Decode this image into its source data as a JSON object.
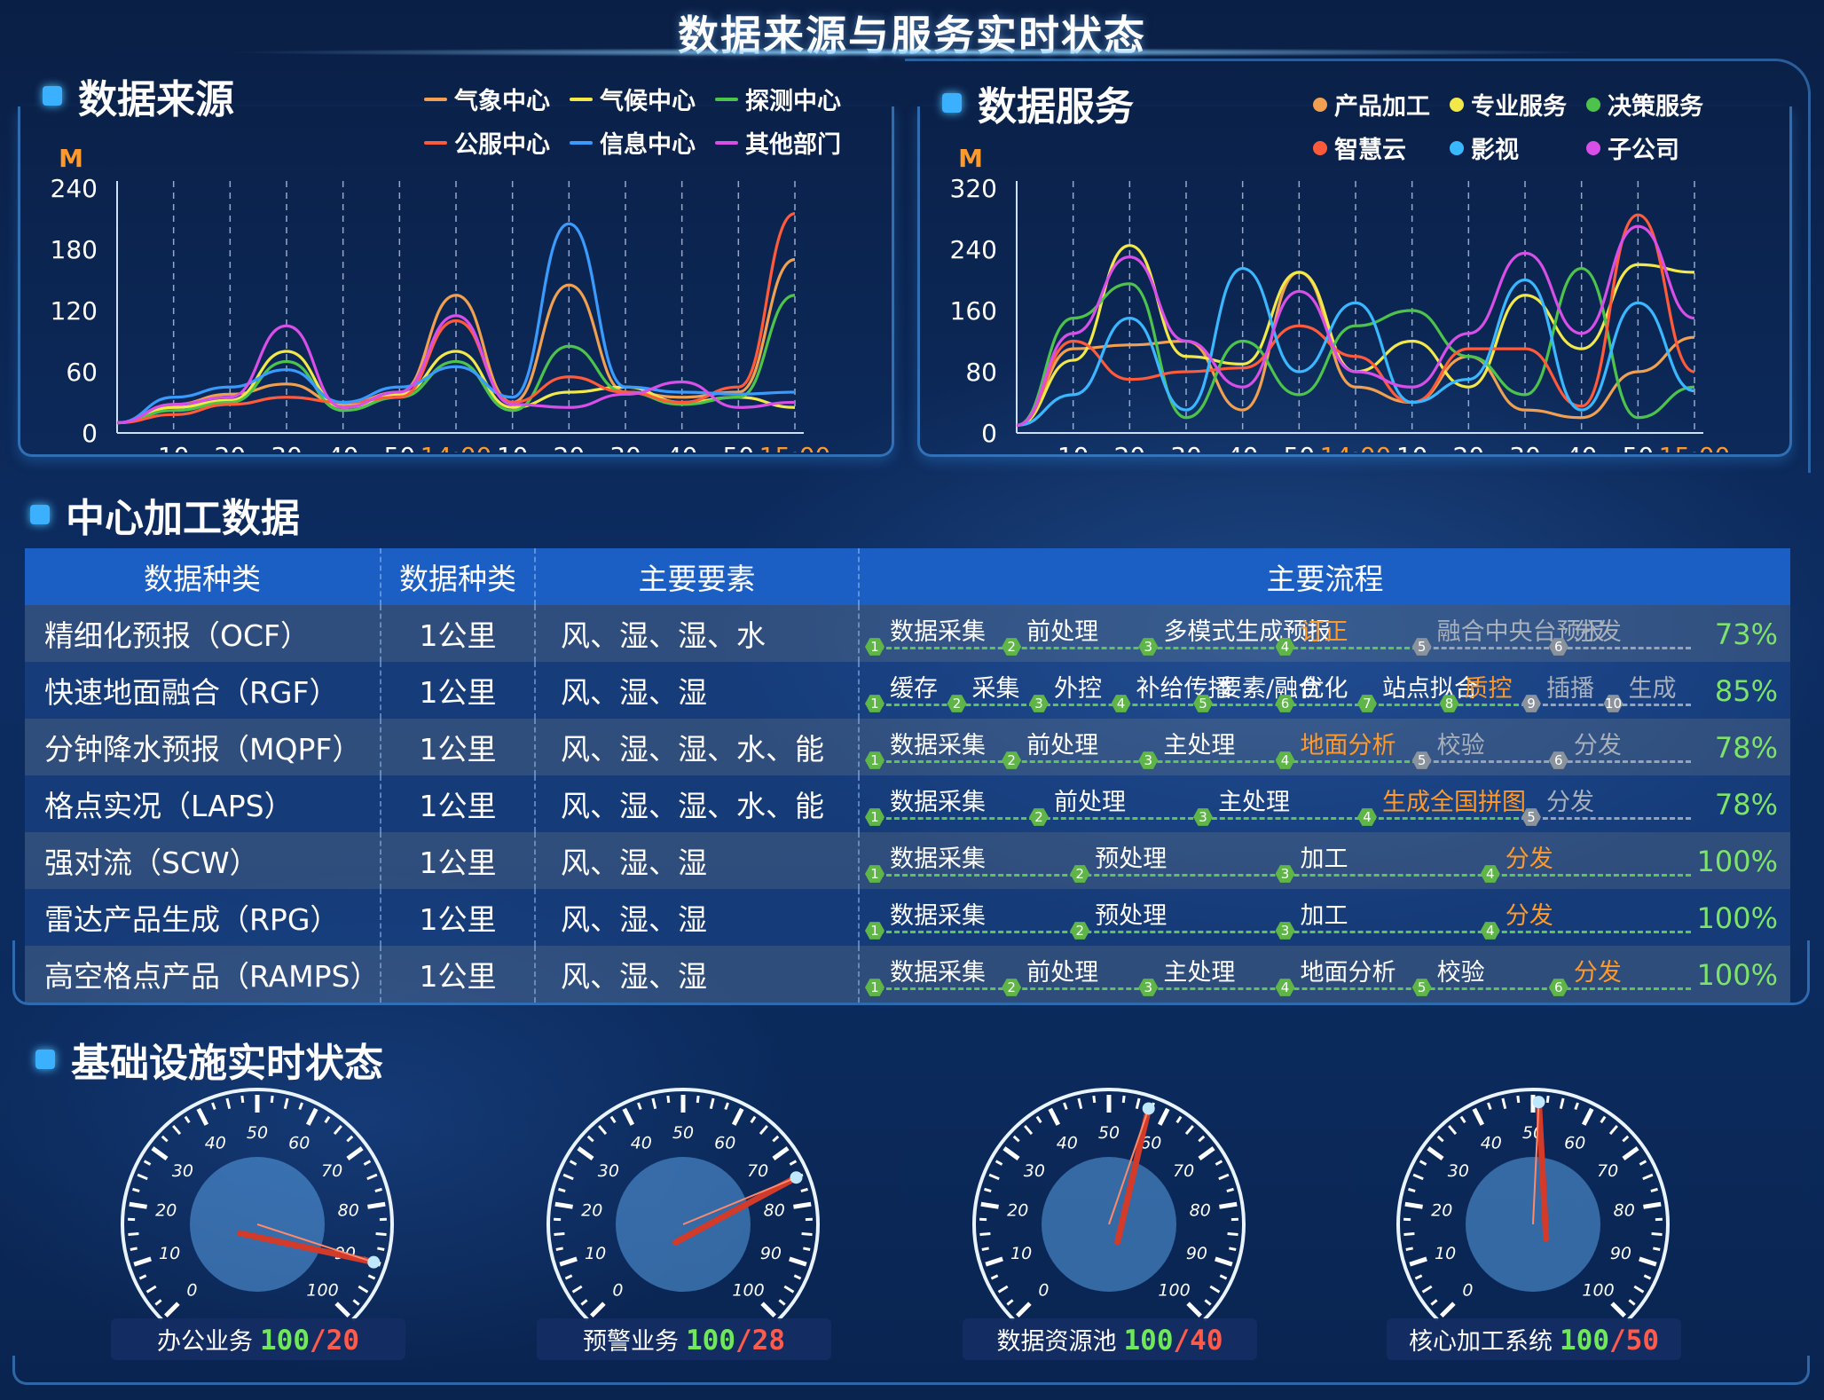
{
  "page_title": "数据来源与服务实时状态",
  "source_panel": {
    "title": "数据来源",
    "unit": "M",
    "legend": [
      {
        "name": "气象中心",
        "color": "#f0a050"
      },
      {
        "name": "气候中心",
        "color": "#f2e84a"
      },
      {
        "name": "探测中心",
        "color": "#4cc44c"
      },
      {
        "name": "公服中心",
        "color": "#ff5a3a"
      },
      {
        "name": "信息中心",
        "color": "#3a9bff"
      },
      {
        "name": "其他部门",
        "color": "#d84fe8"
      }
    ]
  },
  "service_panel": {
    "title": "数据服务",
    "unit": "M",
    "legend": [
      {
        "name": "产品加工",
        "color": "#f0a050"
      },
      {
        "name": "专业服务",
        "color": "#f2e84a"
      },
      {
        "name": "决策服务",
        "color": "#4cc44c"
      },
      {
        "name": "智慧云",
        "color": "#ff5a3a"
      },
      {
        "name": "影视",
        "color": "#3ab8ff"
      },
      {
        "name": "子公司",
        "color": "#d84fe8"
      }
    ]
  },
  "chart_data": [
    {
      "type": "line",
      "title": "数据来源",
      "ylabel": "M",
      "ylim": [
        0,
        240
      ],
      "yticks": [
        "0",
        "60",
        "120",
        "180",
        "240"
      ],
      "x": [
        "",
        "10",
        "20",
        "30",
        "40",
        "50",
        "14:00",
        "10",
        "20",
        "30",
        "40",
        "50",
        "15:00"
      ],
      "highlight_ticks": [
        "14:00",
        "15:00"
      ],
      "series": [
        {
          "name": "气象中心",
          "color": "#f0a050",
          "values": [
            10,
            28,
            38,
            48,
            28,
            40,
            135,
            30,
            145,
            40,
            35,
            40,
            170
          ]
        },
        {
          "name": "气候中心",
          "color": "#f2e84a",
          "values": [
            10,
            25,
            32,
            80,
            25,
            38,
            80,
            25,
            40,
            45,
            30,
            35,
            25
          ]
        },
        {
          "name": "探测中心",
          "color": "#4cc44c",
          "values": [
            10,
            22,
            30,
            70,
            22,
            35,
            70,
            22,
            85,
            40,
            28,
            35,
            135
          ]
        },
        {
          "name": "公服中心",
          "color": "#ff5a3a",
          "values": [
            10,
            18,
            28,
            35,
            30,
            35,
            110,
            30,
            55,
            40,
            30,
            45,
            215
          ]
        },
        {
          "name": "信息中心",
          "color": "#3a9bff",
          "values": [
            10,
            35,
            45,
            62,
            30,
            45,
            65,
            35,
            205,
            45,
            40,
            38,
            40
          ]
        },
        {
          "name": "其他部门",
          "color": "#d84fe8",
          "values": [
            10,
            28,
            35,
            105,
            25,
            40,
            115,
            28,
            25,
            38,
            50,
            25,
            30
          ]
        }
      ]
    },
    {
      "type": "line",
      "title": "数据服务",
      "ylabel": "M",
      "ylim": [
        0,
        320
      ],
      "yticks": [
        "0",
        "80",
        "160",
        "240",
        "320"
      ],
      "x": [
        "",
        "10",
        "20",
        "30",
        "40",
        "50",
        "14:00",
        "10",
        "20",
        "30",
        "40",
        "50",
        "15:00"
      ],
      "highlight_ticks": [
        "14:00",
        "15:00"
      ],
      "series": [
        {
          "name": "产品加工",
          "color": "#f0a050",
          "values": [
            10,
            110,
            115,
            120,
            30,
            210,
            60,
            40,
            100,
            30,
            20,
            80,
            125
          ]
        },
        {
          "name": "专业服务",
          "color": "#f2e84a",
          "values": [
            10,
            95,
            245,
            100,
            90,
            210,
            80,
            120,
            60,
            180,
            110,
            220,
            210
          ]
        },
        {
          "name": "决策服务",
          "color": "#4cc44c",
          "values": [
            10,
            150,
            195,
            20,
            120,
            50,
            140,
            160,
            100,
            50,
            215,
            20,
            60
          ]
        },
        {
          "name": "智慧云",
          "color": "#ff5a3a",
          "values": [
            10,
            120,
            70,
            80,
            85,
            140,
            100,
            40,
            110,
            110,
            35,
            285,
            80
          ]
        },
        {
          "name": "影视",
          "color": "#3ab8ff",
          "values": [
            10,
            50,
            150,
            30,
            215,
            80,
            170,
            40,
            70,
            200,
            30,
            170,
            55
          ]
        },
        {
          "name": "子公司",
          "color": "#d84fe8",
          "values": [
            10,
            130,
            230,
            120,
            60,
            185,
            80,
            60,
            130,
            235,
            130,
            270,
            150
          ]
        }
      ]
    }
  ],
  "center_section": {
    "title": "中心加工数据",
    "headers": [
      "数据种类",
      "数据种类",
      "主要要素",
      "主要流程"
    ],
    "rows": [
      {
        "name": "精细化预报（OCF）",
        "res": "1公里",
        "elements": "风、湿、湿、水",
        "pct": "73%",
        "steps": [
          "数据采集",
          "前处理",
          "多模式生成预报",
          "订正",
          "融合中央台预报",
          "分发"
        ],
        "current": 3
      },
      {
        "name": "快速地面融合（RGF）",
        "res": "1公里",
        "elements": "风、湿、湿",
        "pct": "85%",
        "steps": [
          "缓存",
          "采集",
          "外控",
          "补给传播",
          "要素/融合",
          "优化",
          "站点拟合",
          "质控",
          "插播",
          "生成"
        ],
        "current": 7
      },
      {
        "name": "分钟降水预报（MQPF）",
        "res": "1公里",
        "elements": "风、湿、湿、水、能",
        "pct": "78%",
        "steps": [
          "数据采集",
          "前处理",
          "主处理",
          "地面分析",
          "校验",
          "分发"
        ],
        "current": 3
      },
      {
        "name": "格点实况（LAPS）",
        "res": "1公里",
        "elements": "风、湿、湿、水、能",
        "pct": "78%",
        "steps": [
          "数据采集",
          "前处理",
          "主处理",
          "生成全国拼图",
          "分发"
        ],
        "current": 3
      },
      {
        "name": "强对流（SCW）",
        "res": "1公里",
        "elements": "风、湿、湿",
        "pct": "100%",
        "steps": [
          "数据采集",
          "预处理",
          "加工",
          "分发"
        ],
        "current": 3
      },
      {
        "name": "雷达产品生成（RPG）",
        "res": "1公里",
        "elements": "风、湿、湿",
        "pct": "100%",
        "steps": [
          "数据采集",
          "预处理",
          "加工",
          "分发"
        ],
        "current": 3
      },
      {
        "name": "高空格点产品（RAMPS）",
        "res": "1公里",
        "elements": "风、湿、湿",
        "pct": "100%",
        "steps": [
          "数据采集",
          "前处理",
          "主处理",
          "地面分析",
          "校验",
          "分发"
        ],
        "current": 5
      }
    ]
  },
  "infra_section": {
    "title": "基础设施实时状态",
    "ticks": [
      "0",
      "10",
      "20",
      "30",
      "40",
      "50",
      "60",
      "70",
      "80",
      "90",
      "100"
    ],
    "gauges": [
      {
        "label": "办公业务",
        "max": "100",
        "value": "20",
        "reading": 90
      },
      {
        "label": "预警业务",
        "max": "100",
        "value": "28",
        "reading": 75
      },
      {
        "label": "数据资源池",
        "max": "100",
        "value": "40",
        "reading": 57
      },
      {
        "label": "核心加工系统",
        "max": "100",
        "value": "50",
        "reading": 51
      }
    ]
  },
  "colors": {
    "accent": "#3bb0ff",
    "highlight": "#ff9a2a",
    "done": "#5fc25a",
    "pending": "#9aa3ae"
  }
}
